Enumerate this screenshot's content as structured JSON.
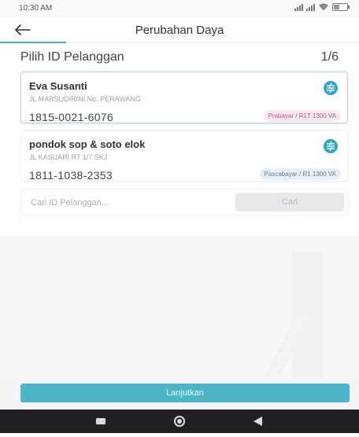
{
  "status_bar": {
    "time": "10:30 AM",
    "icons": [
      "signal-icon",
      "signal-icon",
      "wifi-icon",
      "battery-icon"
    ]
  },
  "header": {
    "back_icon": "arrow-left-icon",
    "title": "Perubahan Daya"
  },
  "section": {
    "title": "Pilih ID Pelanggan",
    "count": "1/6"
  },
  "customers": [
    {
      "name": "Eva Susanti",
      "address": "JL MARSUDIRINI No. PERAWANG",
      "id": "1815-0021-6076",
      "tariff": "Prabayar / R1T 1300 VA",
      "icon": "electricity-icon",
      "selected": true
    },
    {
      "name": "pondok sop & soto elok",
      "address": "JL KASUARI RT 1/7 SKJ",
      "id": "1811-1038-2353",
      "tariff": "Pascabayar / R1 1300 VA",
      "icon": "electricity-icon",
      "selected": false
    }
  ],
  "search": {
    "placeholder": "Cari ID Pelanggan...",
    "value": "",
    "button_label": "Cari"
  },
  "footer": {
    "continue_label": "Lanjutkan"
  },
  "nav_bar": {
    "icons": [
      "recents-icon",
      "home-icon",
      "back-triangle-icon"
    ]
  },
  "colors": {
    "accent": "#4bb6c8",
    "icon": "#2ea7c4",
    "prepaid_badge_bg": "#f6e9f1",
    "postpaid_badge_bg": "#e8eef6"
  }
}
